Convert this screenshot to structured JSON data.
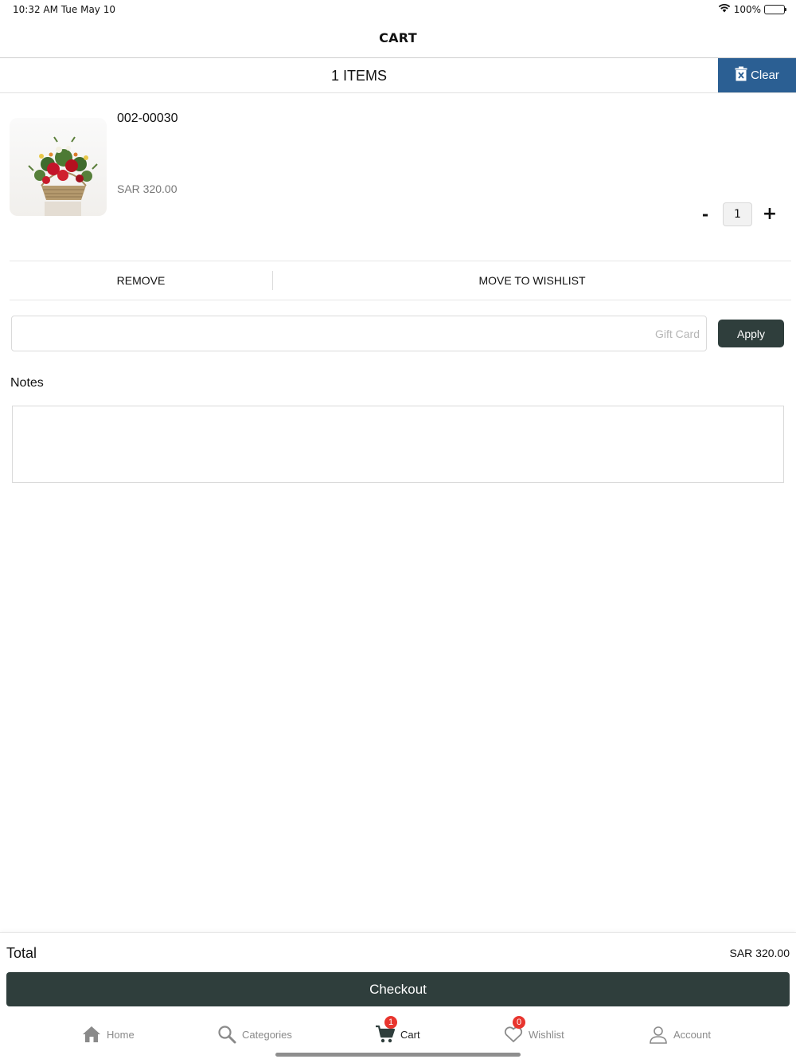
{
  "status_bar": {
    "time": "10:32 AM   Tue May 10",
    "battery": "100%"
  },
  "header": {
    "title": "CART"
  },
  "items_bar": {
    "count": "1 ITEMS",
    "clear_label": "Clear"
  },
  "cart_item": {
    "name": "002-00030",
    "price": "SAR 320.00",
    "quantity": "1",
    "minus": "-",
    "plus": "+"
  },
  "item_actions": {
    "remove": "REMOVE",
    "move_to_wishlist": "MOVE TO WISHLIST"
  },
  "gift_card": {
    "placeholder": "Gift Card",
    "value": "",
    "apply_label": "Apply"
  },
  "notes": {
    "label": "Notes",
    "value": ""
  },
  "summary": {
    "total_label": "Total",
    "total_value": "SAR 320.00",
    "checkout_label": "Checkout"
  },
  "tabs": [
    {
      "label": "Home",
      "icon": "home-icon"
    },
    {
      "label": "Categories",
      "icon": "search-icon"
    },
    {
      "label": "Cart",
      "icon": "cart-icon",
      "badge": "1",
      "active": true
    },
    {
      "label": "Wishlist",
      "icon": "heart-icon",
      "badge": "0"
    },
    {
      "label": "Account",
      "icon": "user-icon"
    }
  ],
  "colors": {
    "clear_bg": "#2b5f93",
    "primary_dark": "#2f3e3c",
    "badge": "#e8352e"
  }
}
